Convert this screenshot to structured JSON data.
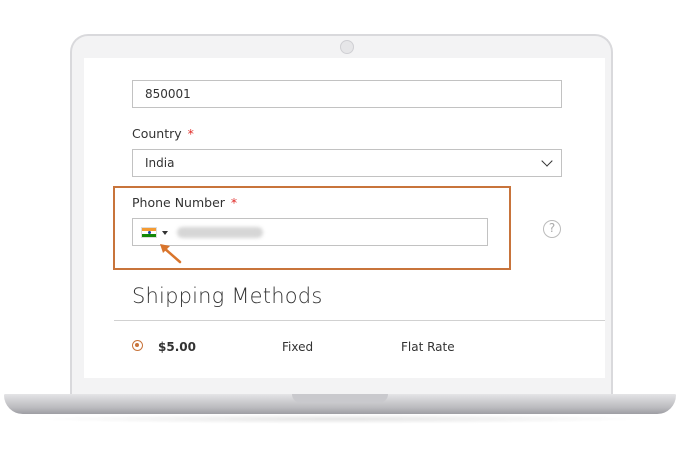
{
  "address": {
    "zip_value": "850001"
  },
  "country": {
    "label": "Country",
    "required_mark": "*",
    "selected": "India"
  },
  "phone": {
    "label": "Phone Number",
    "required_mark": "*",
    "flag": "india-flag-icon",
    "help_symbol": "?"
  },
  "shipping": {
    "title": "Shipping Methods",
    "methods": [
      {
        "price": "$5.00",
        "method": "Fixed",
        "carrier": "Flat Rate",
        "selected": true
      }
    ]
  },
  "colors": {
    "highlight": "#c8743b",
    "required": "#e02b27"
  }
}
